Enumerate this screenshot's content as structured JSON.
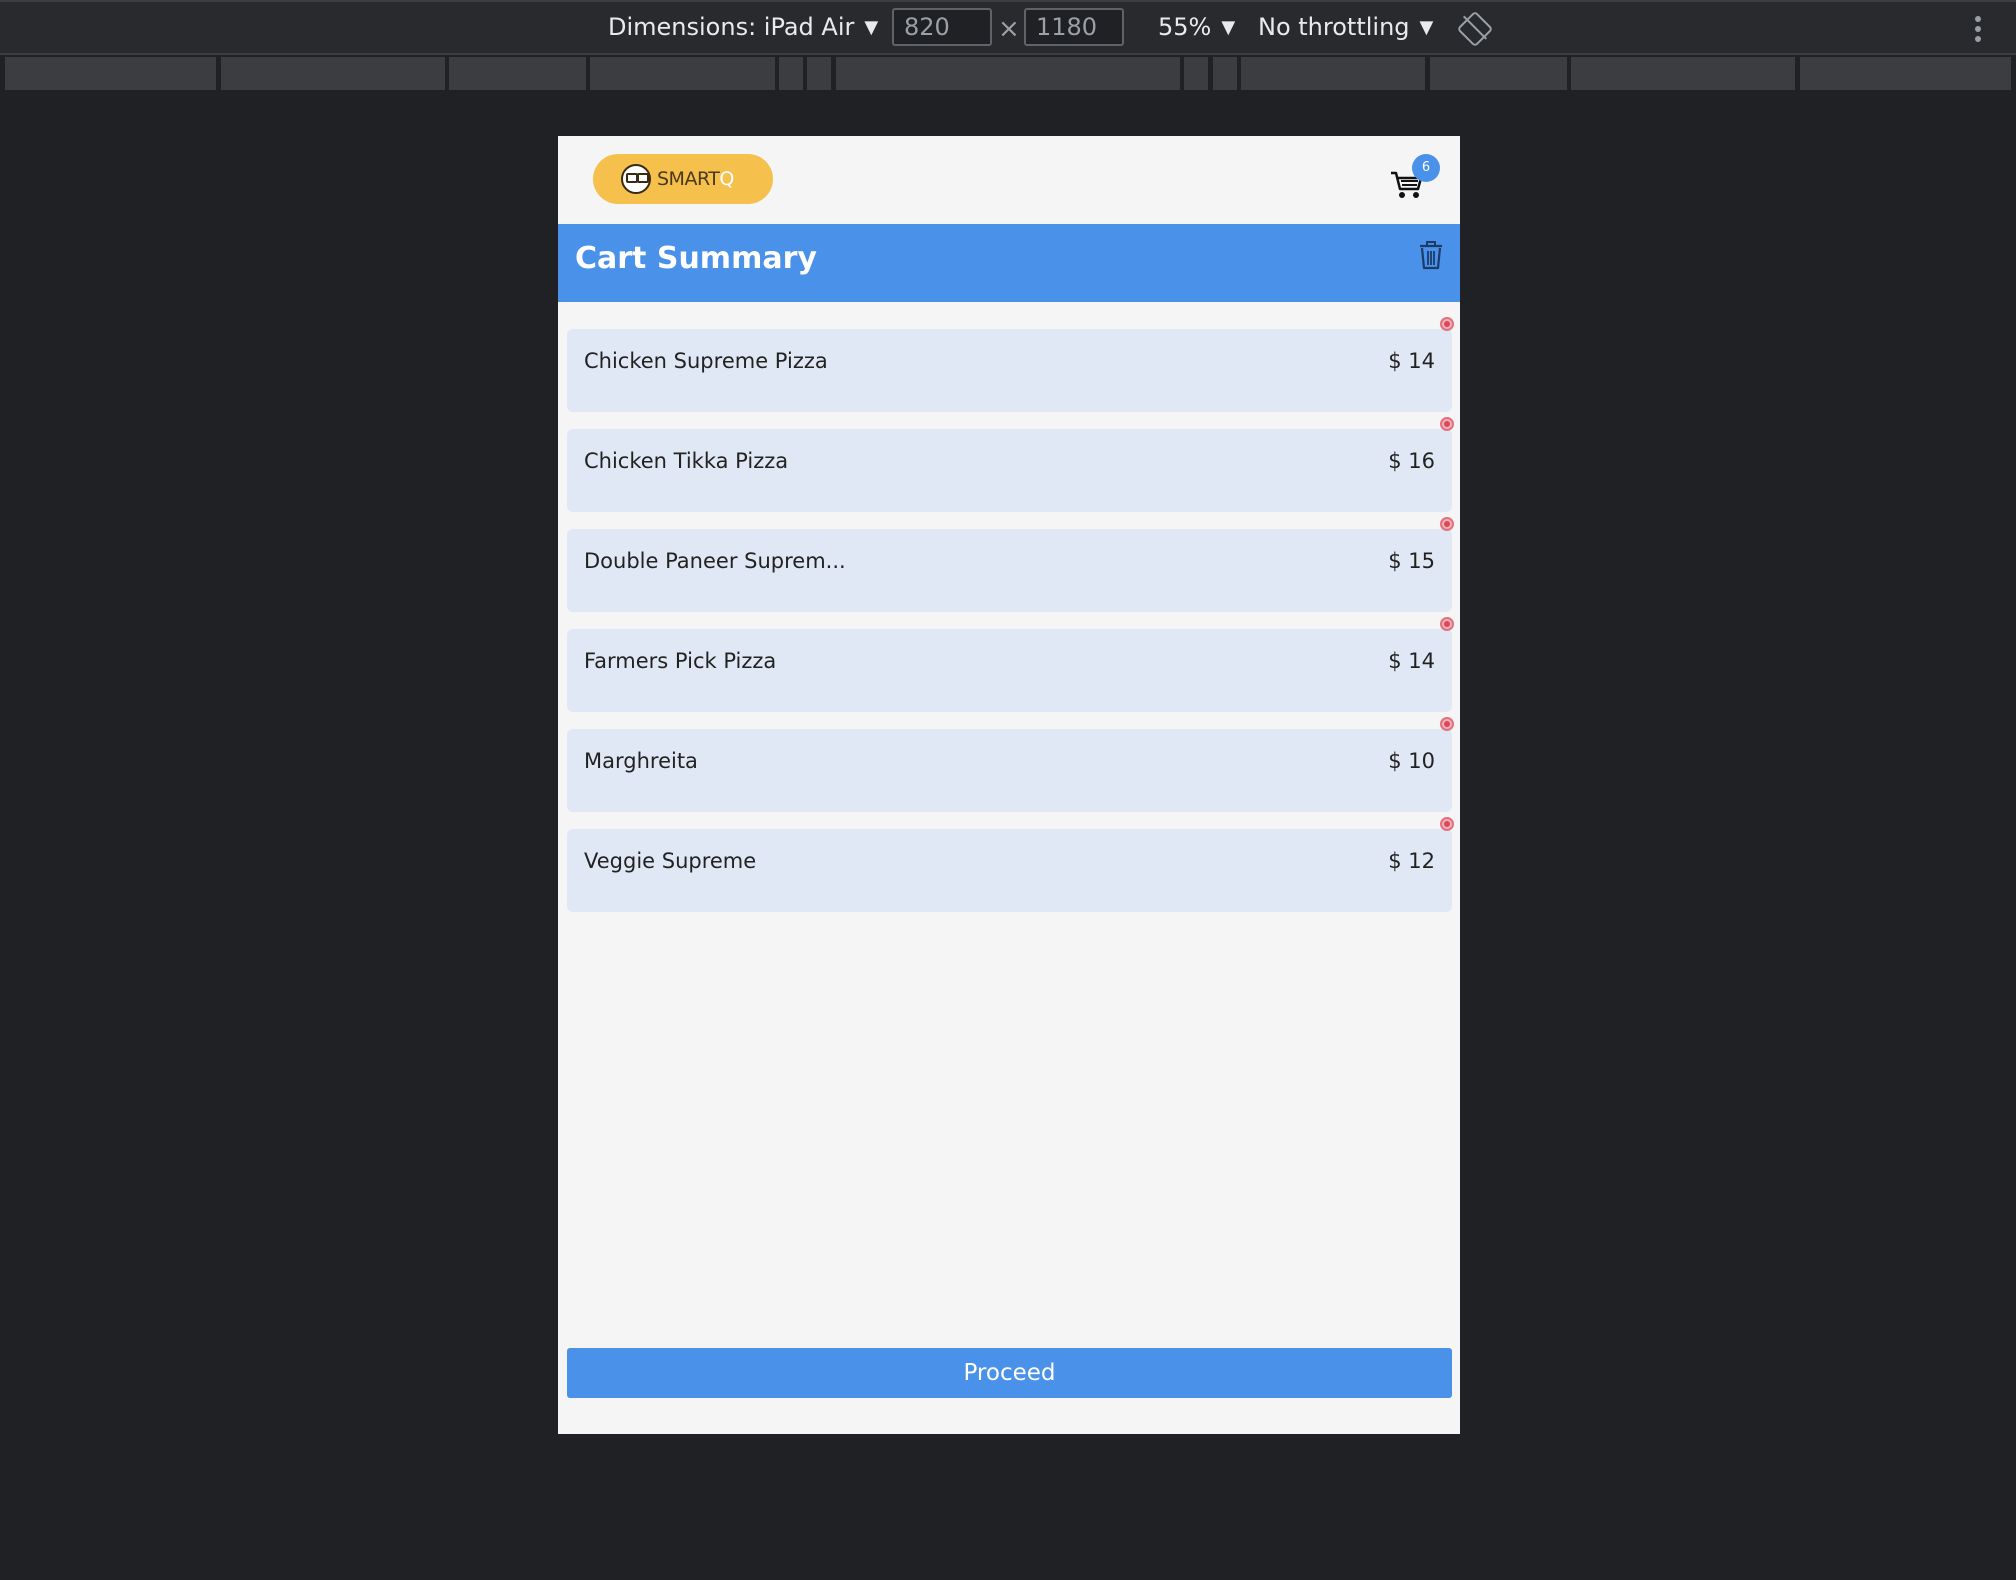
{
  "devtools": {
    "dimensions_label": "Dimensions: iPad Air",
    "width": "820",
    "height": "1180",
    "times": "×",
    "zoom": "55%",
    "throttling": "No throttling",
    "caret": "▼"
  },
  "app": {
    "logo": {
      "smart": "SMART",
      "q": "Q"
    },
    "cart_count": "6",
    "title": "Cart Summary",
    "proceed_label": "Proceed"
  },
  "cart_items": [
    {
      "name": "Chicken Supreme Pizza",
      "price": "$ 14"
    },
    {
      "name": "Chicken Tikka Pizza",
      "price": "$ 16"
    },
    {
      "name": "Double Paneer Suprem...",
      "price": "$ 15"
    },
    {
      "name": "Farmers Pick Pizza",
      "price": "$ 14"
    },
    {
      "name": "Marghreita",
      "price": "$ 10"
    },
    {
      "name": "Veggie Supreme",
      "price": "$ 12"
    }
  ],
  "colors": {
    "accent": "#4a91e9",
    "logo_bg": "#f6c04d",
    "item_bg": "#e1e8f5",
    "devtools_bg": "#202124"
  }
}
